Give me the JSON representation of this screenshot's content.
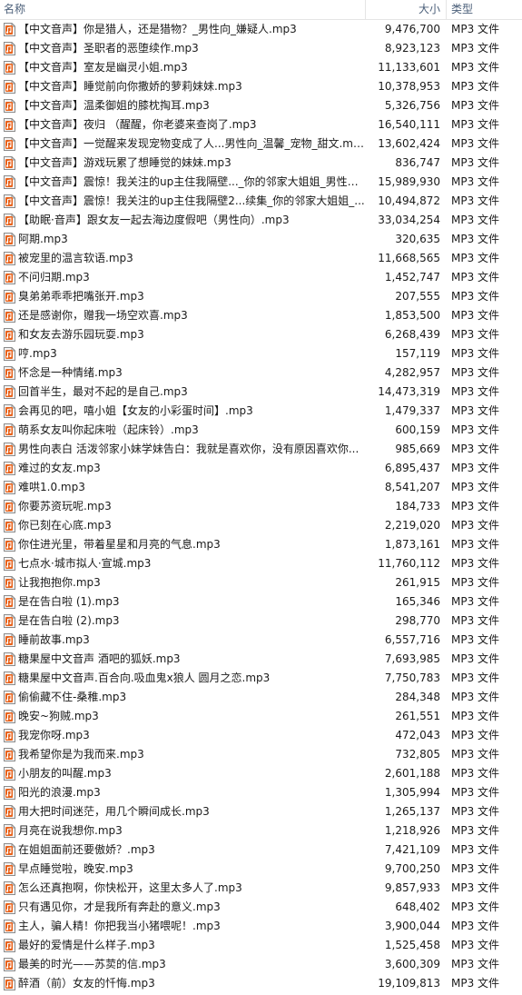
{
  "columns": {
    "name": "名称",
    "size": "大小",
    "type": "类型"
  },
  "icon": "audio-file-icon",
  "files": [
    {
      "name": "【中文音声】你是猎人，还是猎物？_男性向_嫌疑人.mp3",
      "size": "9,476,700",
      "type": "MP3 文件"
    },
    {
      "name": "【中文音声】圣职者的恶堕续作.mp3",
      "size": "8,923,123",
      "type": "MP3 文件"
    },
    {
      "name": "【中文音声】室友是幽灵小姐.mp3",
      "size": "11,133,601",
      "type": "MP3 文件"
    },
    {
      "name": "【中文音声】睡觉前向你撒娇的萝莉妹妹.mp3",
      "size": "10,378,953",
      "type": "MP3 文件"
    },
    {
      "name": "【中文音声】温柔御姐的膝枕掏耳.mp3",
      "size": "5,326,756",
      "type": "MP3 文件"
    },
    {
      "name": "【中文音声】夜归 （醒醒，你老婆来查岗了.mp3",
      "size": "16,540,111",
      "type": "MP3 文件"
    },
    {
      "name": "【中文音声】一觉醒来发现宠物变成了人...男性向_温馨_宠物_甜文.mp3",
      "size": "13,602,424",
      "type": "MP3 文件"
    },
    {
      "name": "【中文音声】游戏玩累了想睡觉的妹妹.mp3",
      "size": "836,747",
      "type": "MP3 文件"
    },
    {
      "name": "【中文音声】震惊！我关注的up主住我隔壁..._你的邻家大姐姐_男性向_...",
      "size": "15,989,930",
      "type": "MP3 文件"
    },
    {
      "name": "【中文音声】震惊！我关注的up主住我隔壁2...续集_你的邻家大姐姐_...",
      "size": "10,494,872",
      "type": "MP3 文件"
    },
    {
      "name": "【助眠·音声】跟女友一起去海边度假吧（男性向）.mp3",
      "size": "33,034,254",
      "type": "MP3 文件"
    },
    {
      "name": "阿期.mp3",
      "size": "320,635",
      "type": "MP3 文件"
    },
    {
      "name": "被宠里的温言软语.mp3",
      "size": "11,668,565",
      "type": "MP3 文件"
    },
    {
      "name": "不问归期.mp3",
      "size": "1,452,747",
      "type": "MP3 文件"
    },
    {
      "name": "臭弟弟乖乖把嘴张开.mp3",
      "size": "207,555",
      "type": "MP3 文件"
    },
    {
      "name": "还是感谢你，赠我一场空欢喜.mp3",
      "size": "1,853,500",
      "type": "MP3 文件"
    },
    {
      "name": "和女友去游乐园玩耍.mp3",
      "size": "6,268,439",
      "type": "MP3 文件"
    },
    {
      "name": "哼.mp3",
      "size": "157,119",
      "type": "MP3 文件"
    },
    {
      "name": "怀念是一种情绪.mp3",
      "size": "4,282,957",
      "type": "MP3 文件"
    },
    {
      "name": "回首半生，最对不起的是自己.mp3",
      "size": "14,473,319",
      "type": "MP3 文件"
    },
    {
      "name": "会再见的吧，嘻小姐【女友的小彩蛋时间】.mp3",
      "size": "1,479,337",
      "type": "MP3 文件"
    },
    {
      "name": "萌系女友叫你起床啦（起床铃）.mp3",
      "size": "600,159",
      "type": "MP3 文件"
    },
    {
      "name": "男性向表白 活泼邻家小妹学妹告白：我就是喜欢你，没有原因喜欢你...",
      "size": "985,669",
      "type": "MP3 文件"
    },
    {
      "name": "难过的女友.mp3",
      "size": "6,895,437",
      "type": "MP3 文件"
    },
    {
      "name": "难哄1.0.mp3",
      "size": "8,541,207",
      "type": "MP3 文件"
    },
    {
      "name": "你要苏资玩呢.mp3",
      "size": "184,733",
      "type": "MP3 文件"
    },
    {
      "name": "你已刻在心底.mp3",
      "size": "2,219,020",
      "type": "MP3 文件"
    },
    {
      "name": "你住进光里，带着星星和月亮的气息.mp3",
      "size": "1,873,161",
      "type": "MP3 文件"
    },
    {
      "name": "七点水·城市拟人·宣城.mp3",
      "size": "11,760,112",
      "type": "MP3 文件"
    },
    {
      "name": "让我抱抱你.mp3",
      "size": "261,915",
      "type": "MP3 文件"
    },
    {
      "name": "是在告白啦 (1).mp3",
      "size": "165,346",
      "type": "MP3 文件"
    },
    {
      "name": "是在告白啦 (2).mp3",
      "size": "298,770",
      "type": "MP3 文件"
    },
    {
      "name": "睡前故事.mp3",
      "size": "6,557,716",
      "type": "MP3 文件"
    },
    {
      "name": "糖果屋中文音声 酒吧的狐妖.mp3",
      "size": "7,693,985",
      "type": "MP3 文件"
    },
    {
      "name": "糖果屋中文音声.百合向.吸血鬼x狼人 圆月之恋.mp3",
      "size": "7,750,783",
      "type": "MP3 文件"
    },
    {
      "name": "偷偷藏不住-桑稚.mp3",
      "size": "284,348",
      "type": "MP3 文件"
    },
    {
      "name": "晚安~狗贼.mp3",
      "size": "261,551",
      "type": "MP3 文件"
    },
    {
      "name": "我宠你呀.mp3",
      "size": "472,043",
      "type": "MP3 文件"
    },
    {
      "name": "我希望你是为我而来.mp3",
      "size": "732,805",
      "type": "MP3 文件"
    },
    {
      "name": "小朋友的叫醒.mp3",
      "size": "2,601,188",
      "type": "MP3 文件"
    },
    {
      "name": "阳光的浪漫.mp3",
      "size": "1,305,994",
      "type": "MP3 文件"
    },
    {
      "name": "用大把时间迷茫，用几个瞬间成长.mp3",
      "size": "1,265,137",
      "type": "MP3 文件"
    },
    {
      "name": "月亮在说我想你.mp3",
      "size": "1,218,926",
      "type": "MP3 文件"
    },
    {
      "name": "在姐姐面前还要傲娇？.mp3",
      "size": "7,421,109",
      "type": "MP3 文件"
    },
    {
      "name": "早点睡觉啦，晚安.mp3",
      "size": "9,700,250",
      "type": "MP3 文件"
    },
    {
      "name": "怎么还真抱啊，你快松开，这里太多人了.mp3",
      "size": "9,857,933",
      "type": "MP3 文件"
    },
    {
      "name": "只有遇见你，才是我所有奔赴的意义.mp3",
      "size": "648,402",
      "type": "MP3 文件"
    },
    {
      "name": "主人，骗人精！你把我当小猪喂呢！.mp3",
      "size": "3,900,044",
      "type": "MP3 文件"
    },
    {
      "name": "最好的爱情是什么样子.mp3",
      "size": "1,525,458",
      "type": "MP3 文件"
    },
    {
      "name": "最美的时光——苏荬的信.mp3",
      "size": "3,600,309",
      "type": "MP3 文件"
    },
    {
      "name": "醉酒（前）女友的忏悔.mp3",
      "size": "19,109,813",
      "type": "MP3 文件"
    }
  ]
}
